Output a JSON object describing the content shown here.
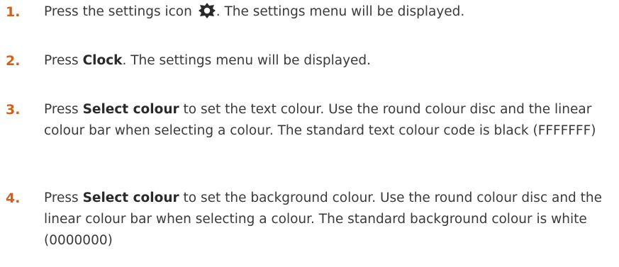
{
  "steps": [
    {
      "number": "1.",
      "before_icon": "Press the settings icon ",
      "icon": "gear-icon",
      "after_icon": ". The settings menu will be displayed."
    },
    {
      "number": "2.",
      "prefix": "Press ",
      "bold": "Clock",
      "suffix": ". The settings menu will be displayed."
    },
    {
      "number": "3.",
      "prefix": "Press ",
      "bold": "Select colour",
      "suffix": " to set the text colour. Use the round colour disc and the linear colour bar when selecting a colour. The standard text colour code is black (FFFFFFF)"
    },
    {
      "number": "4.",
      "prefix": "Press ",
      "bold": "Select colour",
      "suffix": " to set the background colour. Use the round colour disc and the linear colour bar when selecting a colour. The standard background colour is white (0000000)"
    }
  ],
  "colors": {
    "step_number": "#d2601a",
    "body_text": "#3a3a3a",
    "icon": "#2a2a2a"
  }
}
